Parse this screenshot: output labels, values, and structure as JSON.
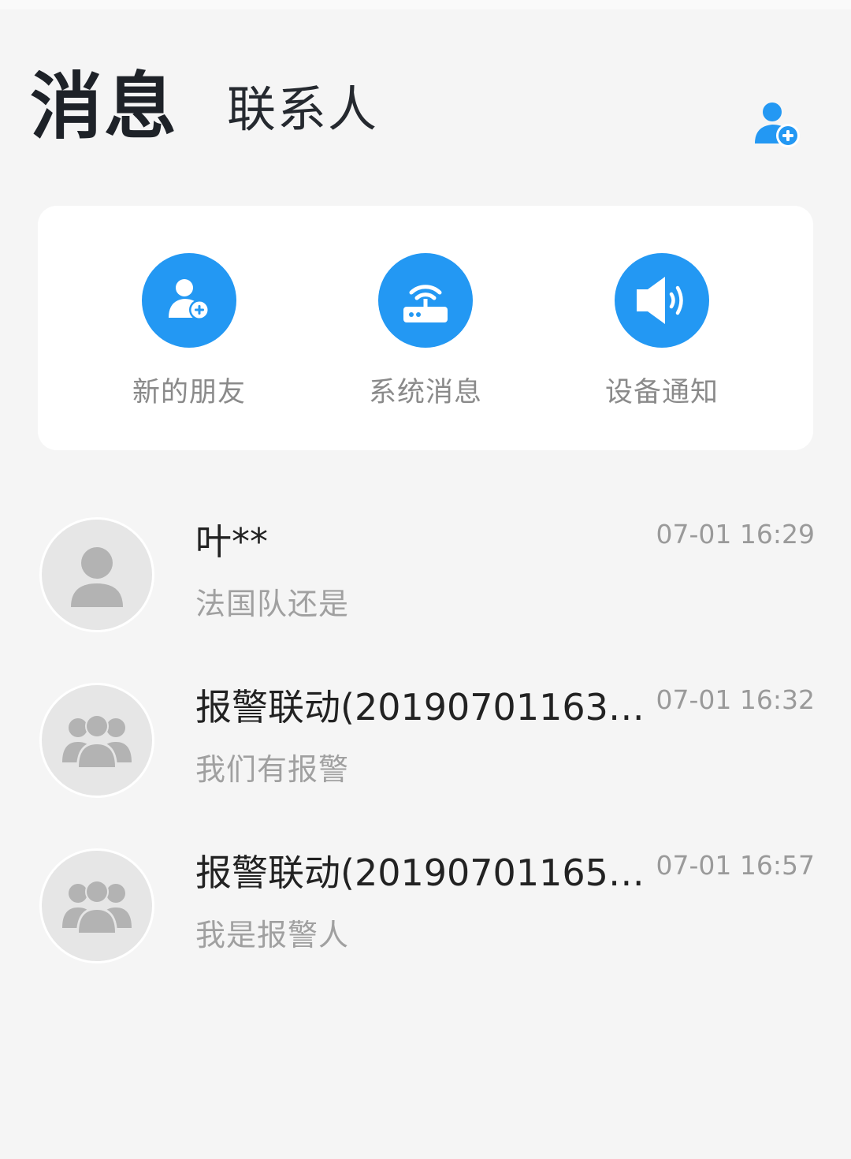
{
  "header": {
    "tabs": [
      {
        "label": "消息",
        "active": true
      },
      {
        "label": "联系人",
        "active": false
      }
    ],
    "add_contact_icon": "add-user-icon"
  },
  "quick_actions": [
    {
      "label": "新的朋友",
      "icon": "add-user-icon"
    },
    {
      "label": "系统消息",
      "icon": "router-icon"
    },
    {
      "label": "设备通知",
      "icon": "speaker-icon"
    }
  ],
  "conversations": [
    {
      "title": "叶**",
      "time": "07-01 16:29",
      "preview": "法国队还是",
      "avatar": "person-icon"
    },
    {
      "title": "报警联动(20190701163…",
      "time": "07-01 16:32",
      "preview": "我们有报警",
      "avatar": "group-icon"
    },
    {
      "title": "报警联动(20190701165…",
      "time": "07-01 16:57",
      "preview": "我是报警人",
      "avatar": "group-icon"
    }
  ],
  "colors": {
    "accent": "#2398f3",
    "background": "#f5f5f5",
    "card": "#ffffff",
    "muted_text": "#9a9a9a"
  }
}
